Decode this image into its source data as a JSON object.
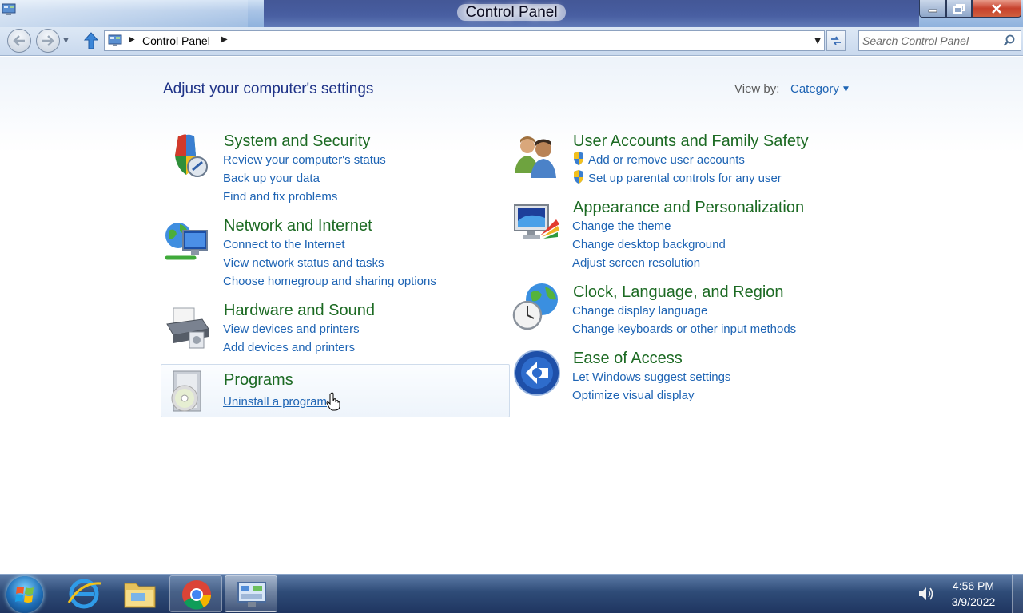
{
  "window": {
    "title": "Control Panel",
    "icons": {
      "app": "control-panel-icon",
      "minimize": "minimize-icon",
      "maximize": "maximize-icon",
      "close": "close-icon"
    }
  },
  "address_bar": {
    "path": "Control Panel",
    "search_placeholder": "Search Control Panel"
  },
  "main": {
    "heading": "Adjust your computer's settings",
    "view_by_label": "View by:",
    "view_by_value": "Category"
  },
  "categories": {
    "system_security": {
      "title": "System and Security",
      "icon": "shield-icon",
      "links": [
        "Review your computer's status",
        "Back up your data",
        "Find and fix problems"
      ]
    },
    "network_internet": {
      "title": "Network and Internet",
      "icon": "network-globe-icon",
      "links": [
        "Connect to the Internet",
        "View network status and tasks",
        "Choose homegroup and sharing options"
      ]
    },
    "hardware_sound": {
      "title": "Hardware and Sound",
      "icon": "printer-icon",
      "links": [
        "View devices and printers",
        "Add devices and printers"
      ]
    },
    "programs": {
      "title": "Programs",
      "icon": "programs-disc-icon",
      "links": [
        "Uninstall a program"
      ]
    },
    "user_accounts": {
      "title": "User Accounts and Family Safety",
      "icon": "users-icon",
      "links": [
        "Add or remove user accounts",
        "Set up parental controls for any user"
      ]
    },
    "appearance": {
      "title": "Appearance and Personalization",
      "icon": "monitor-palette-icon",
      "links": [
        "Change the theme",
        "Change desktop background",
        "Adjust screen resolution"
      ]
    },
    "clock_region": {
      "title": "Clock, Language, and Region",
      "icon": "clock-globe-icon",
      "links": [
        "Change display language",
        "Change keyboards or other input methods"
      ]
    },
    "ease_access": {
      "title": "Ease of Access",
      "icon": "ease-of-access-icon",
      "links": [
        "Let Windows suggest settings",
        "Optimize visual display"
      ]
    }
  },
  "taskbar": {
    "items": [
      "start-orb",
      "internet-explorer-icon",
      "file-explorer-icon",
      "chrome-icon",
      "control-panel-icon"
    ],
    "clock_time": "4:56 PM",
    "clock_date": "3/9/2022"
  },
  "colors": {
    "category_title": "#1c6a23",
    "link": "#1e64b4",
    "heading": "#1e3287"
  }
}
